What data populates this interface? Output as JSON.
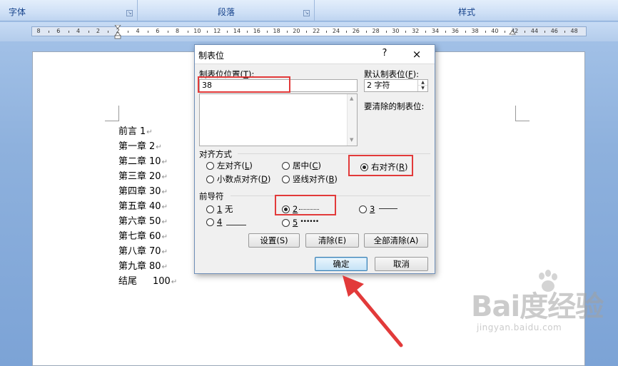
{
  "ribbon": {
    "groups": [
      {
        "label": "字体"
      },
      {
        "label": "段落"
      },
      {
        "label": "样式"
      }
    ]
  },
  "ruler": {
    "ticks": [
      "8",
      "6",
      "4",
      "2",
      "2",
      "4",
      "6",
      "8",
      "10",
      "12",
      "14",
      "16",
      "18",
      "20",
      "22",
      "24",
      "26",
      "28",
      "30",
      "32",
      "34",
      "36",
      "38",
      "40",
      "42",
      "44",
      "46",
      "48"
    ]
  },
  "document": {
    "lines": [
      {
        "title": "前言",
        "num": "1"
      },
      {
        "title": "第一章",
        "num": "2"
      },
      {
        "title": "第二章",
        "num": "10"
      },
      {
        "title": "第三章",
        "num": "20"
      },
      {
        "title": "第四章",
        "num": "30"
      },
      {
        "title": "第五章",
        "num": "40"
      },
      {
        "title": "第六章",
        "num": "50"
      },
      {
        "title": "第七章",
        "num": "60"
      },
      {
        "title": "第八章",
        "num": "70"
      },
      {
        "title": "第九章",
        "num": "80"
      },
      {
        "title": "结尾",
        "num": "100"
      }
    ],
    "para_mark": "↵"
  },
  "dialog": {
    "title": "制表位",
    "help": "?",
    "close": "×",
    "tab_position_label": "制表位位置",
    "tab_position_key": "T",
    "tab_position_value": "38",
    "default_tab_label": "默认制表位",
    "default_tab_key": "F",
    "default_tab_value": "2 字符",
    "to_clear_label": "要清除的制表位:",
    "alignment": {
      "title": "对齐方式",
      "options": [
        {
          "label": "左对齐",
          "key": "L",
          "selected": false
        },
        {
          "label": "居中",
          "key": "C",
          "selected": false
        },
        {
          "label": "右对齐",
          "key": "R",
          "selected": true
        },
        {
          "label": "小数点对齐",
          "key": "D",
          "selected": false
        },
        {
          "label": "竖线对齐",
          "key": "B",
          "selected": false
        }
      ]
    },
    "leader": {
      "title": "前导符",
      "options": [
        {
          "key": "1",
          "label": "无",
          "selected": false
        },
        {
          "key": "2",
          "label": "",
          "selected": true
        },
        {
          "key": "3",
          "label": "",
          "selected": false
        },
        {
          "key": "4",
          "label": "",
          "selected": false
        },
        {
          "key": "5",
          "label": "",
          "selected": false
        }
      ]
    },
    "buttons": {
      "set": "设置(S)",
      "clear": "清除(E)",
      "clear_all": "全部清除(A)",
      "ok": "确定",
      "cancel": "取消"
    }
  },
  "watermark": {
    "brand": "Bai度经验",
    "url": "jingyan.baidu.com"
  },
  "colors": {
    "highlight": "#e23a3a",
    "ribbon_text": "#15428b",
    "workspace": "#8eb1dd"
  }
}
